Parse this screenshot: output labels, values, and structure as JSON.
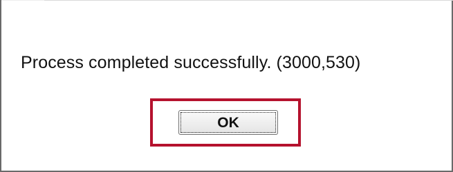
{
  "dialog": {
    "message": "Process completed successfully. (3000,530)",
    "ok_label": "OK",
    "highlight_color": "#b5122e"
  }
}
